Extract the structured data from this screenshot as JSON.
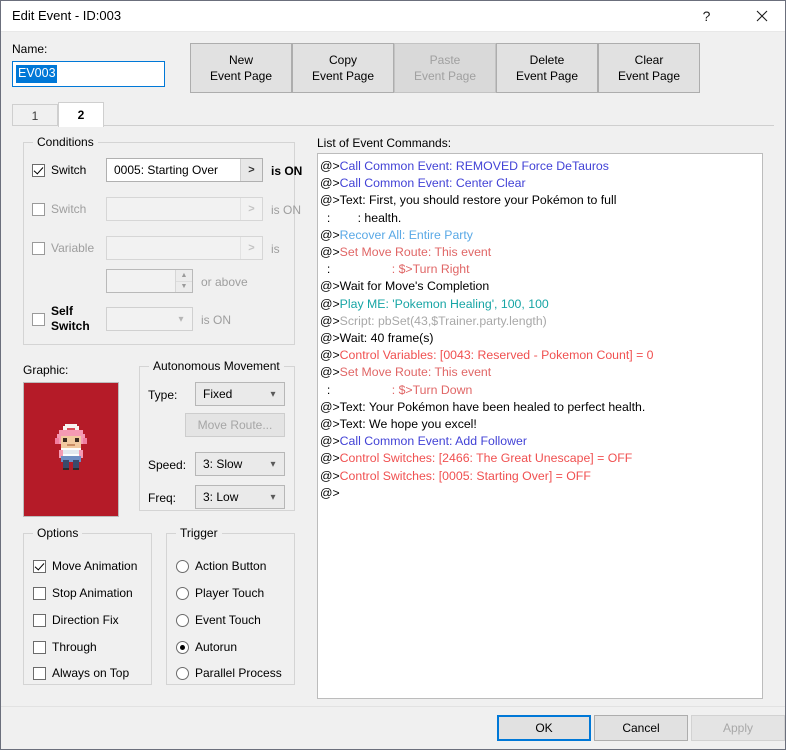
{
  "window": {
    "title": "Edit Event - ID:003",
    "help_icon": "question-mark-icon",
    "close_icon": "close-icon"
  },
  "name_field": {
    "label": "Name:",
    "value": "EV003"
  },
  "toolbar": {
    "new_event_page": "New\nEvent Page",
    "new_l1": "New",
    "new_l2": "Event Page",
    "copy_l1": "Copy",
    "copy_l2": "Event Page",
    "paste_l1": "Paste",
    "paste_l2": "Event Page",
    "delete_l1": "Delete",
    "delete_l2": "Event Page",
    "clear_l1": "Clear",
    "clear_l2": "Event Page"
  },
  "tabs": [
    {
      "label": "1",
      "active": false
    },
    {
      "label": "2",
      "active": true
    }
  ],
  "conditions": {
    "legend": "Conditions",
    "switch1": {
      "label": "Switch",
      "checked": true,
      "value": "0005: Starting Over",
      "arrow": ">",
      "suffix": "is ON"
    },
    "switch2": {
      "label": "Switch",
      "checked": false,
      "value": "",
      "arrow": ">",
      "suffix": "is ON"
    },
    "variable": {
      "label": "Variable",
      "checked": false,
      "value": "",
      "arrow": ">",
      "suffix": "is"
    },
    "variable_value": {
      "value": "",
      "suffix": "or above",
      "up": "▲",
      "down": "▼"
    },
    "self_switch": {
      "label_l1": "Self",
      "label_l2": "Switch",
      "checked": false,
      "value": "",
      "arrow": "⌄",
      "suffix": "is ON"
    }
  },
  "graphic": {
    "label": "Graphic:",
    "background_color": "#b51b28",
    "sprite_name": "nurse-sprite"
  },
  "autonomous_movement": {
    "legend": "Autonomous Movement",
    "type_label": "Type:",
    "type_value": "Fixed",
    "move_route_button": "Move Route...",
    "speed_label": "Speed:",
    "speed_value": "3: Slow",
    "freq_label": "Freq:",
    "freq_value": "3: Low",
    "chevron": "⌄"
  },
  "options": {
    "legend": "Options",
    "items": [
      {
        "label": "Move Animation",
        "checked": true
      },
      {
        "label": "Stop Animation",
        "checked": false
      },
      {
        "label": "Direction Fix",
        "checked": false
      },
      {
        "label": "Through",
        "checked": false
      },
      {
        "label": "Always on Top",
        "checked": false
      }
    ]
  },
  "trigger": {
    "legend": "Trigger",
    "items": [
      {
        "label": "Action Button",
        "checked": false
      },
      {
        "label": "Player Touch",
        "checked": false
      },
      {
        "label": "Event Touch",
        "checked": false
      },
      {
        "label": "Autorun",
        "checked": true
      },
      {
        "label": "Parallel Process",
        "checked": false
      }
    ]
  },
  "command_list": {
    "label": "List of Event Commands:",
    "colors": {
      "default": "#000000",
      "call_common_event": "#4242d6",
      "recover_all": "#5aa9e6",
      "play_me": "#17a5a5",
      "script": "#a8a8a8",
      "set_move_route": "#e06666",
      "control_variables": "#f05050",
      "control_switches": "#f05050"
    },
    "lines": [
      {
        "prefix": "@>",
        "text": "Call Common Event: REMOVED Force DeTauros",
        "color": "#4242d6"
      },
      {
        "prefix": "@>",
        "text": "Call Common Event: Center Clear",
        "color": "#4242d6"
      },
      {
        "prefix": "@>",
        "text": "Text: First, you should restore your Pokémon to full",
        "color": "#000000"
      },
      {
        "prefix": "  :",
        "text": "        : health.",
        "color": "#000000"
      },
      {
        "prefix": "@>",
        "text": "Recover All: Entire Party",
        "color": "#5aa9e6"
      },
      {
        "prefix": "@>",
        "text": "Set Move Route: This event",
        "color": "#e06666"
      },
      {
        "prefix": "  :",
        "text": "                  : $>Turn Right",
        "color": "#e06666"
      },
      {
        "prefix": "@>",
        "text": "Wait for Move's Completion",
        "color": "#000000"
      },
      {
        "prefix": "@>",
        "text": "Play ME: 'Pokemon Healing', 100, 100",
        "color": "#17a5a5"
      },
      {
        "prefix": "@>",
        "text": "Script: pbSet(43,$Trainer.party.length)",
        "color": "#a8a8a8"
      },
      {
        "prefix": "@>",
        "text": "Wait: 40 frame(s)",
        "color": "#000000"
      },
      {
        "prefix": "@>",
        "text": "Control Variables: [0043: Reserved - Pokemon Count] = 0",
        "color": "#f05050"
      },
      {
        "prefix": "@>",
        "text": "Set Move Route: This event",
        "color": "#e06666"
      },
      {
        "prefix": "  :",
        "text": "                  : $>Turn Down",
        "color": "#e06666"
      },
      {
        "prefix": "@>",
        "text": "Text: Your Pokémon have been healed to perfect health.",
        "color": "#000000"
      },
      {
        "prefix": "@>",
        "text": "Text: We hope you excel!",
        "color": "#000000"
      },
      {
        "prefix": "@>",
        "text": "Call Common Event: Add Follower",
        "color": "#4242d6"
      },
      {
        "prefix": "@>",
        "text": "Control Switches: [2466: The Great Unescape] = OFF",
        "color": "#f05050"
      },
      {
        "prefix": "@>",
        "text": "Control Switches: [0005: Starting Over] = OFF",
        "color": "#f05050"
      },
      {
        "prefix": "@>",
        "text": "",
        "color": "#000000"
      }
    ]
  },
  "footer": {
    "ok": "OK",
    "cancel": "Cancel",
    "apply": "Apply"
  }
}
